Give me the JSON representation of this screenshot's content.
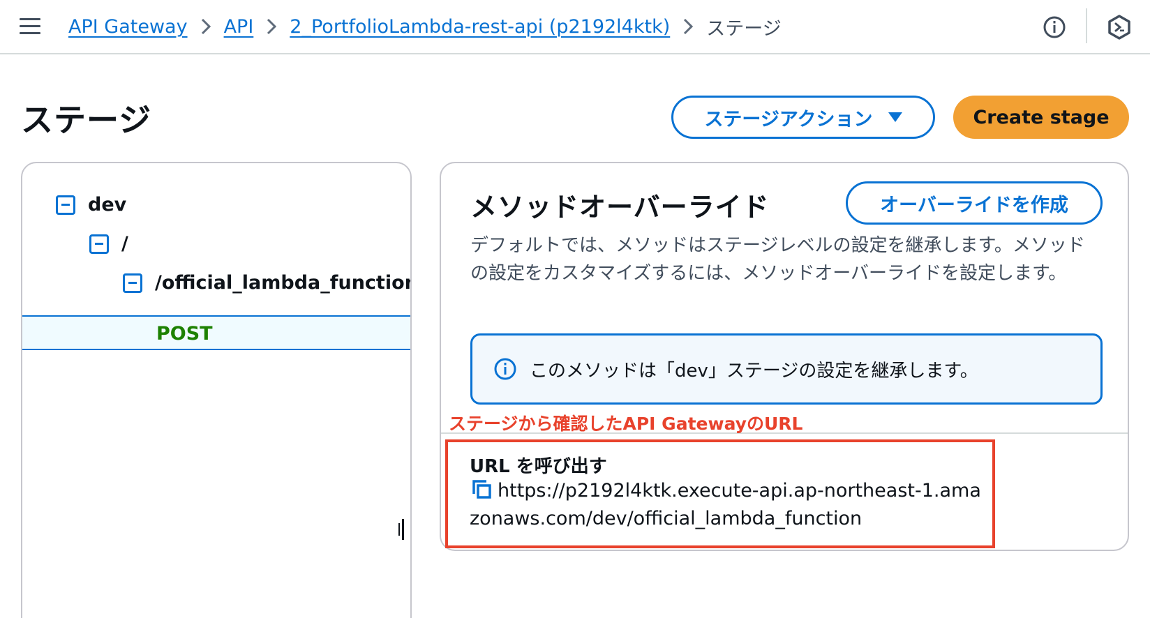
{
  "breadcrumbs": {
    "items": [
      "API Gateway",
      "API",
      "2_PortfolioLambda-rest-api (p2192l4ktk)"
    ],
    "current": "ステージ"
  },
  "topbar": {
    "menu_icon": "hamburger-menu-icon",
    "info_icon": "info-icon",
    "right_icon": "cloudshell-hex-icon"
  },
  "page": {
    "title": "ステージ",
    "actions_button": "ステージアクション",
    "create_button": "Create stage"
  },
  "tree": {
    "stage": "dev",
    "root_resource": "/",
    "resource": "/official_lambda_function",
    "method": "POST"
  },
  "override": {
    "title": "メソッドオーバーライド",
    "create_button": "オーバーライドを作成",
    "description": "デフォルトでは、メソッドはステージレベルの設定を継承します。メソッドの設定をカスタマイズするには、メソッドオーバーライドを設定します。",
    "info_message": "このメソッドは「dev」ステージの設定を継承します。"
  },
  "annotation": {
    "label": "ステージから確認したAPI GatewayのURL",
    "color": "#e8422c"
  },
  "invoke": {
    "label": "URL を呼び出す",
    "url": "https://p2192l4ktk.execute-api.ap-northeast-1.amazonaws.com/dev/official_lambda_function"
  },
  "colors": {
    "link": "#0972d3",
    "primary_button": "#f2a033",
    "method_post": "#1d8102"
  }
}
